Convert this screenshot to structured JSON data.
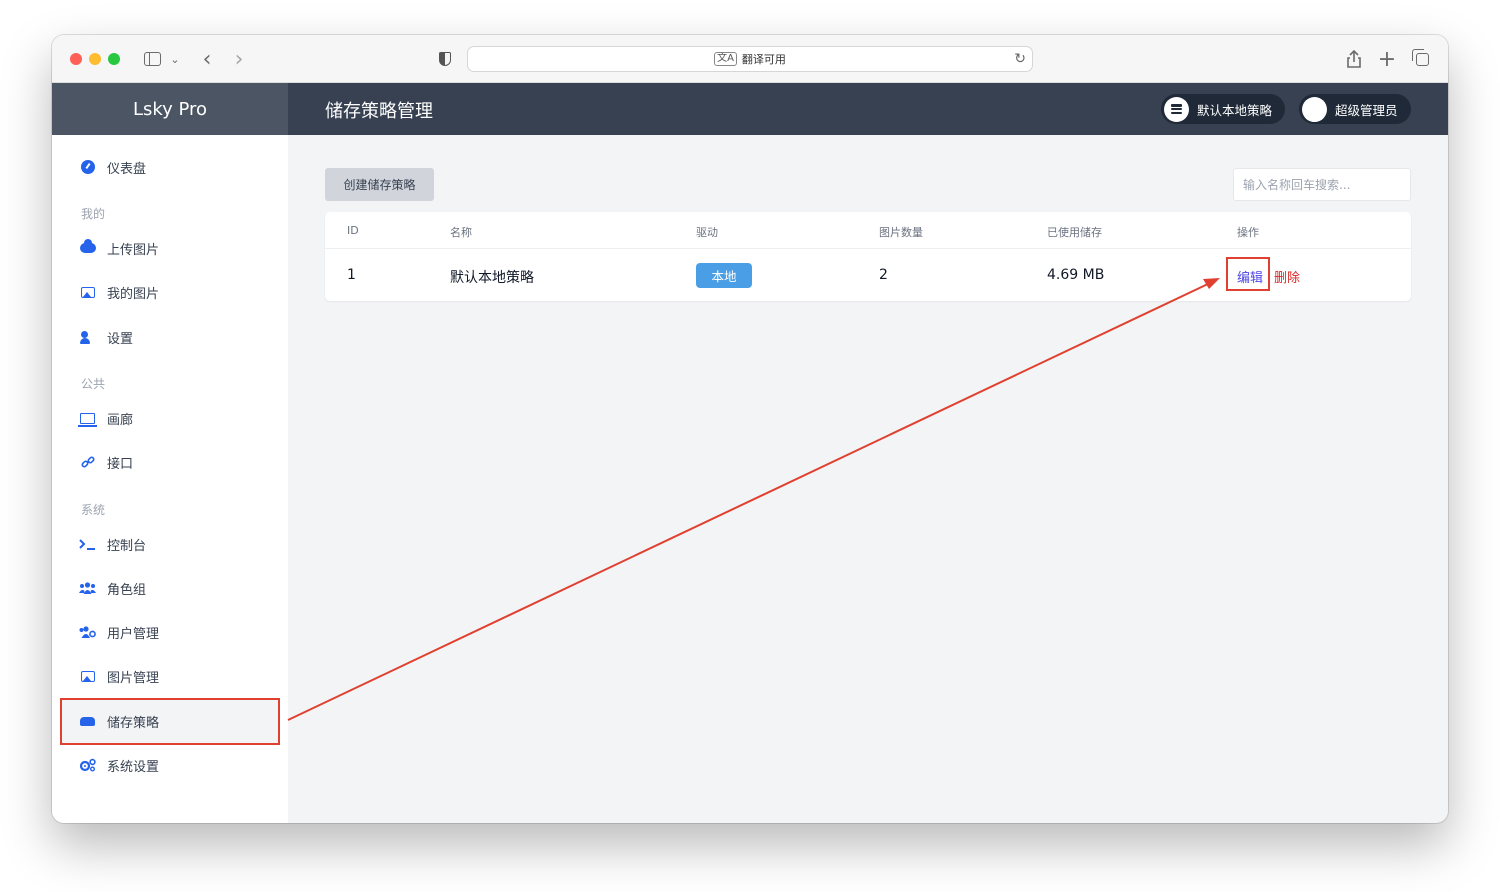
{
  "browser": {
    "url_text": "翻译可用",
    "translate_icon": "文A"
  },
  "app": {
    "brand": "Lsky Pro",
    "page_title": "储存策略管理",
    "header_strategy": "默认本地策略",
    "header_user": "超级管理员"
  },
  "sidebar": {
    "dashboard": "仪表盘",
    "section_mine": "我的",
    "upload": "上传图片",
    "my_images": "我的图片",
    "settings": "设置",
    "section_public": "公共",
    "gallery": "画廊",
    "api": "接口",
    "section_system": "系统",
    "console": "控制台",
    "roles": "角色组",
    "users": "用户管理",
    "images": "图片管理",
    "strategies": "储存策略",
    "system_settings": "系统设置"
  },
  "main": {
    "create_button": "创建储存策略",
    "search_placeholder": "输入名称回车搜索...",
    "columns": [
      "ID",
      "名称",
      "驱动",
      "图片数量",
      "已使用储存",
      "操作"
    ],
    "rows": [
      {
        "id": "1",
        "name": "默认本地策略",
        "driver": "本地",
        "image_count": "2",
        "used_storage": "4.69 MB",
        "edit": "编辑",
        "delete": "删除"
      }
    ]
  },
  "colors": {
    "accent": "#2563eb",
    "header": "#374151",
    "brand_bg": "#4b5563",
    "annotation": "#e0402f",
    "badge": "#4a9ee5",
    "delete": "#dc2626"
  }
}
